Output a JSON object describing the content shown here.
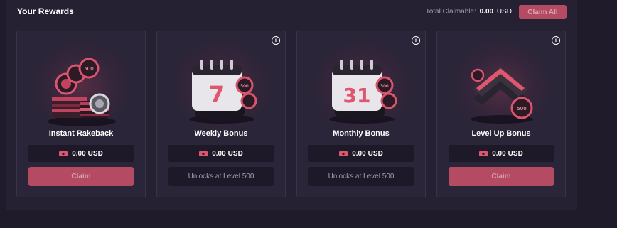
{
  "header": {
    "title": "Your Rewards",
    "total_label": "Total Claimable:",
    "total_amount": "0.00",
    "total_currency": "USD",
    "claim_all_label": "Claim All"
  },
  "colors": {
    "accent": "#b54a63",
    "background": "#1f1b2a",
    "card": "#2a2538"
  },
  "cards": [
    {
      "title": "Instant Rakeback",
      "amount": "0.00",
      "currency": "USD",
      "action_label": "Claim",
      "action_type": "claim",
      "art_icon": "chip-stack-icon",
      "info": false
    },
    {
      "title": "Weekly Bonus",
      "amount": "0.00",
      "currency": "USD",
      "action_label": "Unlocks at Level 500",
      "action_type": "locked",
      "art_icon": "calendar-7-icon",
      "art_number": "7",
      "info": true
    },
    {
      "title": "Monthly Bonus",
      "amount": "0.00",
      "currency": "USD",
      "action_label": "Unlocks at Level 500",
      "action_type": "locked",
      "art_icon": "calendar-31-icon",
      "art_number": "31",
      "info": true
    },
    {
      "title": "Level Up Bonus",
      "amount": "0.00",
      "currency": "USD",
      "action_label": "Claim",
      "action_type": "claim",
      "art_icon": "level-chevron-icon",
      "info": true
    }
  ],
  "chip_label": "500"
}
